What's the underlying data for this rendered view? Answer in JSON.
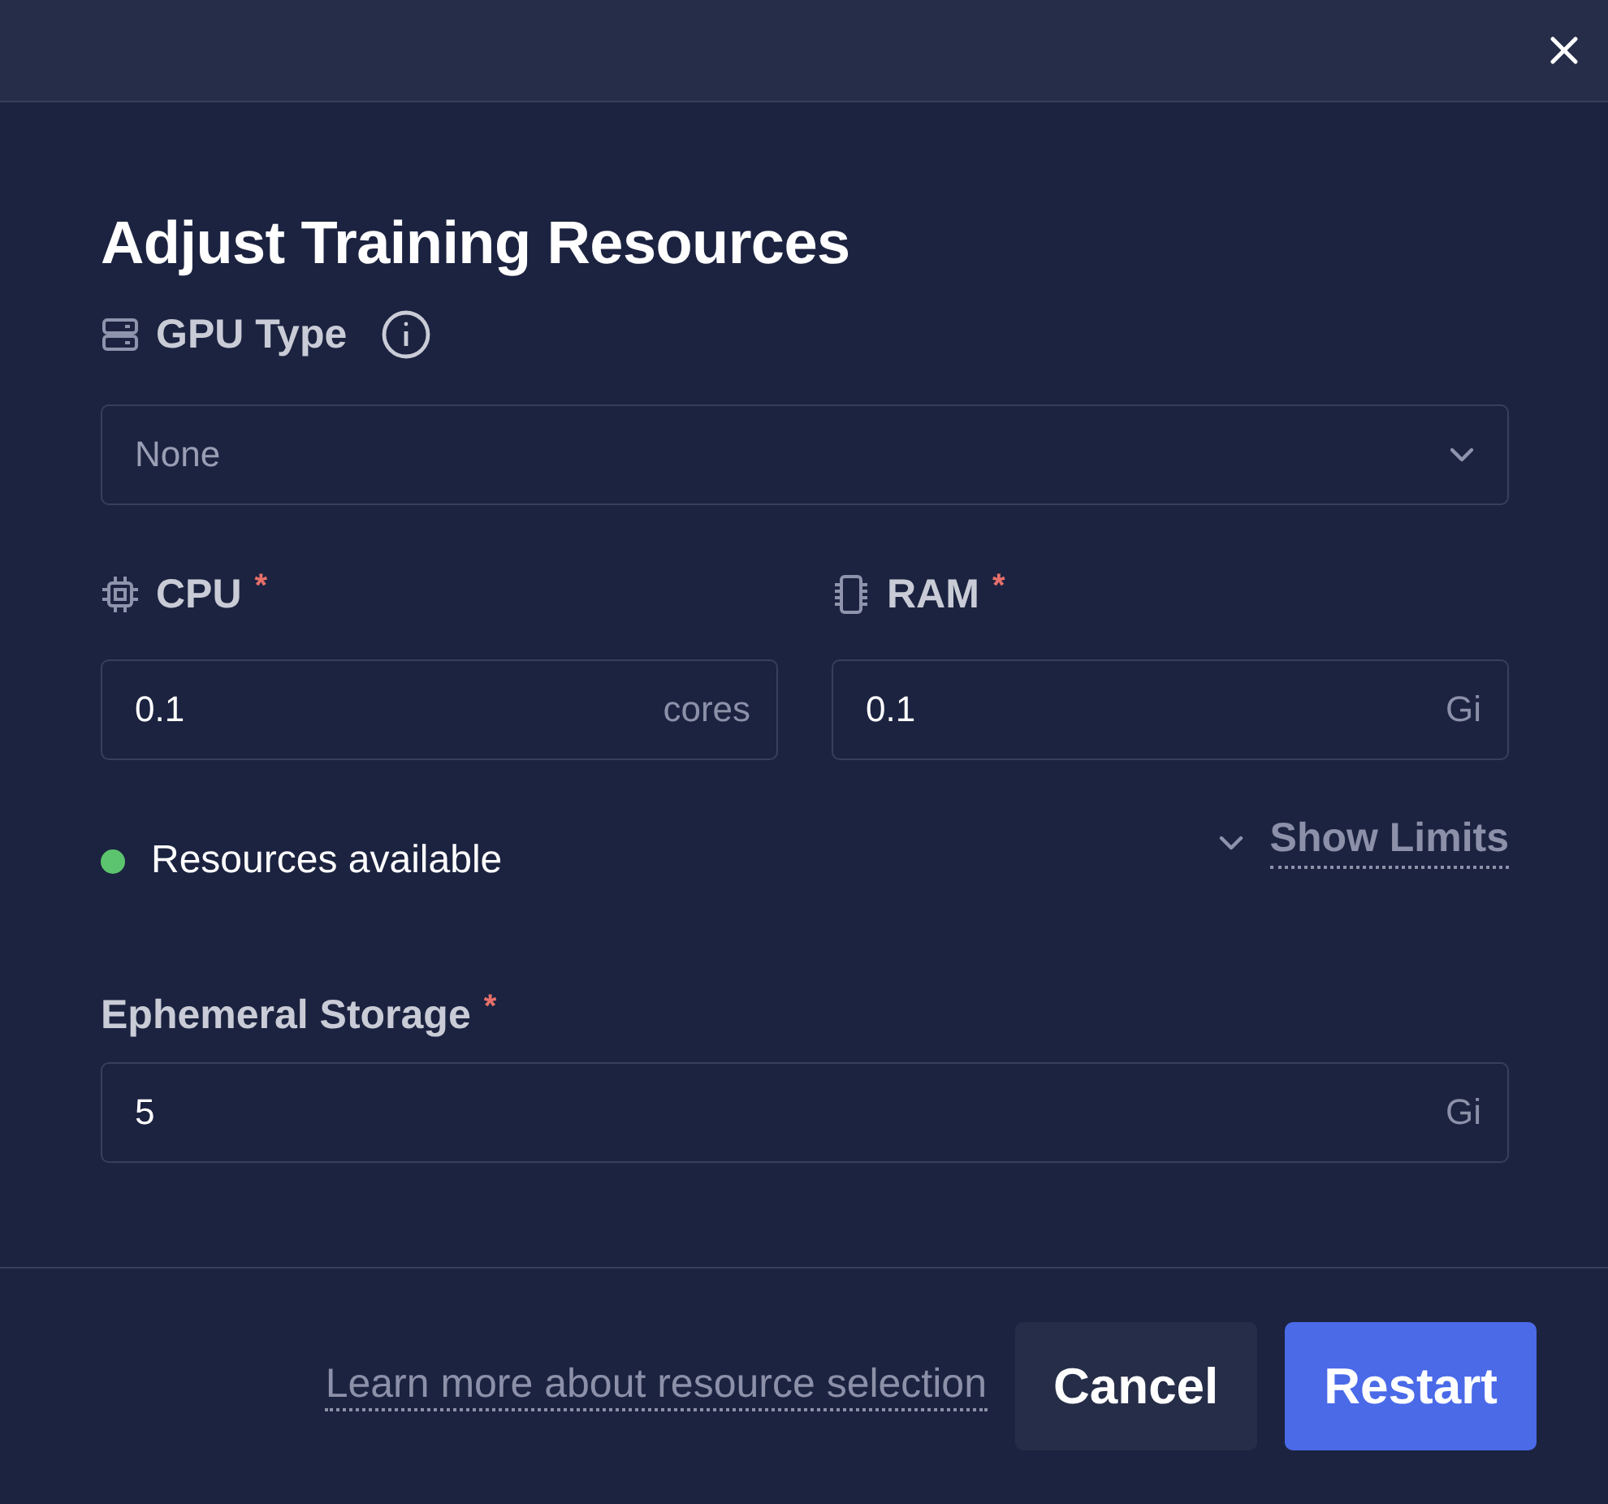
{
  "dialog": {
    "title": "Adjust Training Resources"
  },
  "gpu_type": {
    "label": "GPU Type",
    "value": "None"
  },
  "cpu": {
    "label": "CPU",
    "required_mark": "*",
    "value": "0.1",
    "unit": "cores"
  },
  "ram": {
    "label": "RAM",
    "required_mark": "*",
    "value": "0.1",
    "unit": "Gi"
  },
  "status": {
    "text": "Resources available",
    "available": true
  },
  "limits_toggle": {
    "label": "Show Limits",
    "expanded": false
  },
  "ephemeral_storage": {
    "label": "Ephemeral Storage",
    "required_mark": "*",
    "value": "5",
    "unit": "Gi"
  },
  "footer": {
    "link": "Learn more about resource selection",
    "buttons": [
      {
        "label": "Cancel",
        "kind": "secondary"
      },
      {
        "label": "Restart",
        "kind": "primary"
      }
    ]
  }
}
